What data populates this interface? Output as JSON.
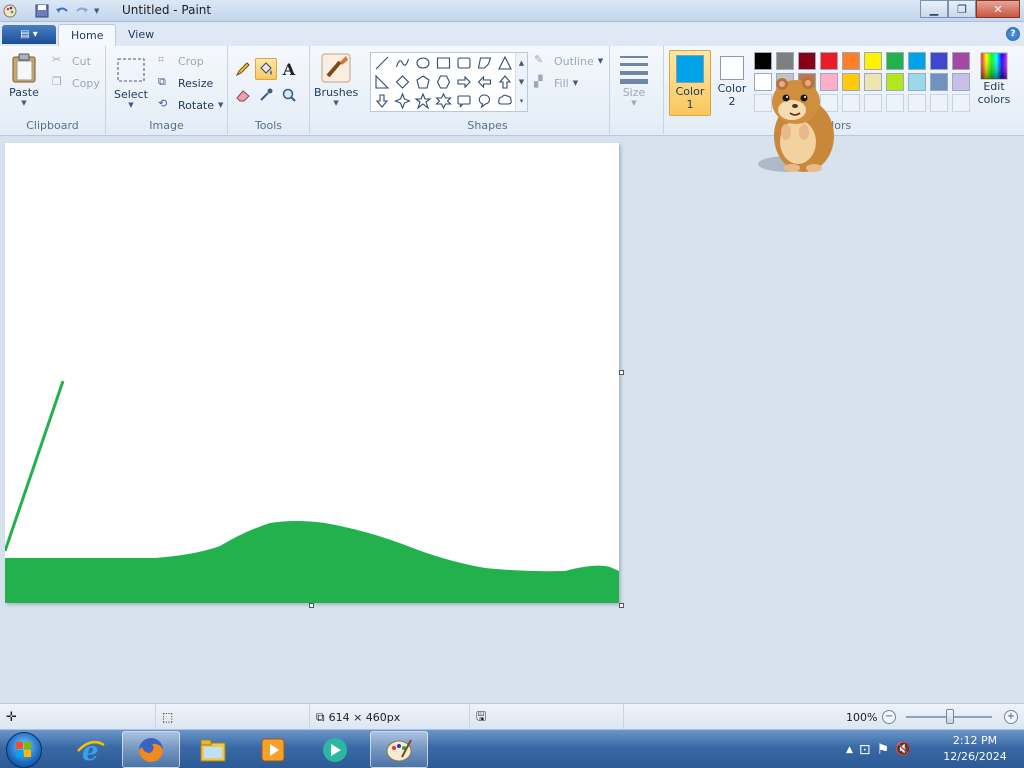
{
  "window": {
    "title": "Untitled - Paint",
    "controls": [
      "minimize",
      "restore",
      "close"
    ]
  },
  "tabs": [
    {
      "label": "Home",
      "active": true
    },
    {
      "label": "View",
      "active": false
    }
  ],
  "ribbon": {
    "clipboard": {
      "group_label": "Clipboard",
      "paste": "Paste",
      "cut": "Cut",
      "copy": "Copy"
    },
    "image": {
      "group_label": "Image",
      "select": "Select",
      "crop": "Crop",
      "resize": "Resize",
      "rotate": "Rotate"
    },
    "tools": {
      "group_label": "Tools",
      "items": [
        "pencil-icon",
        "fill-icon",
        "text-icon",
        "eraser-icon",
        "color-picker-icon",
        "magnifier-icon"
      ],
      "active": "fill-icon"
    },
    "brushes": {
      "label": "Brushes"
    },
    "shapes": {
      "group_label": "Shapes",
      "outline": "Outline",
      "fill": "Fill"
    },
    "size": {
      "label": "Size"
    },
    "colors": {
      "group_label": "Colors",
      "color1_label": "Color 1",
      "color1_line1": "Color",
      "color1_line2": "1",
      "color2_label": "Color 2",
      "color2_line1": "Color",
      "color2_line2": "2",
      "color1_value": "#00a2e8",
      "color2_value": "#ffffff",
      "edit_line1": "Edit",
      "edit_line2": "colors",
      "palette_row1": [
        "#000000",
        "#7f7f7f",
        "#880015",
        "#ed1c24",
        "#ff7f27",
        "#fff200",
        "#22b14c",
        "#00a2e8",
        "#3f48cc",
        "#a349a4"
      ],
      "palette_row2": [
        "#ffffff",
        "#c3c3c3",
        "#b97a57",
        "#ffaec9",
        "#ffc90e",
        "#efe4b0",
        "#b5e61d",
        "#99d9ea",
        "#7092be",
        "#c8bfe7"
      ]
    }
  },
  "canvas": {
    "fill_color": "#22b14c"
  },
  "statusbar": {
    "dimensions": "614 × 460px",
    "zoom": "100%"
  },
  "taskbar": {
    "time": "2:12 PM",
    "date": "12/26/2024"
  }
}
